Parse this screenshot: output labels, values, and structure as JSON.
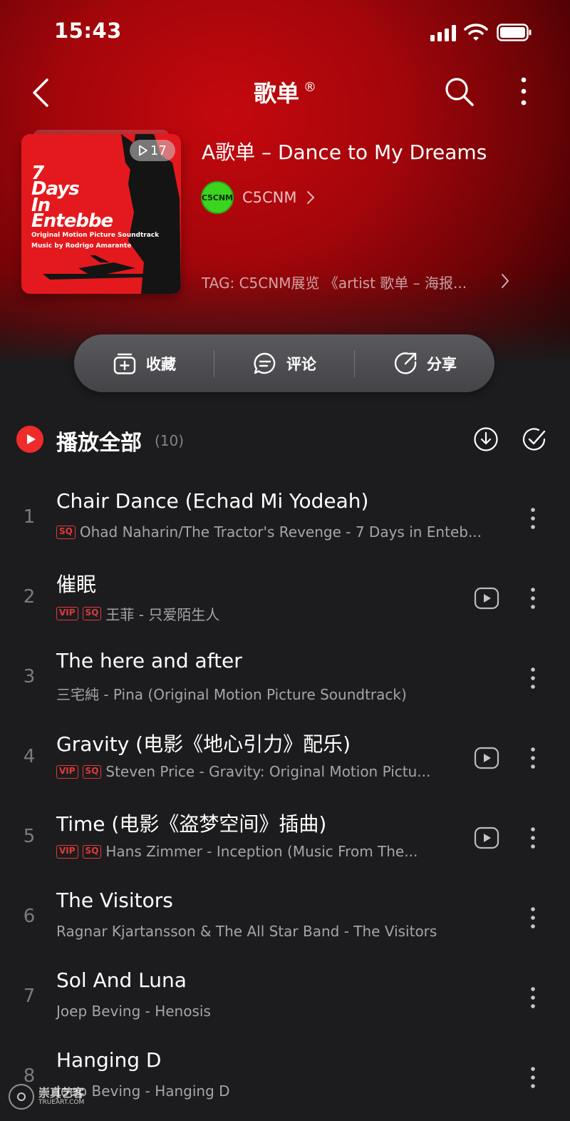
{
  "status_bar": {
    "time": "15:43"
  },
  "nav": {
    "title": "歌单",
    "title_mark": "®"
  },
  "playlist": {
    "cover": {
      "line1": "7",
      "line2": "Days",
      "line3": "In",
      "line4": "Entebbe",
      "line5": "Original Motion Picture Soundtrack",
      "line6": "Music by Rodrigo Amarante"
    },
    "play_count": "17",
    "title": "A歌单 – Dance to My Dreams",
    "creator_avatar_text": "C5CNM",
    "creator": "C5CNM",
    "tag_line": "TAG: C5CNM展览 《artist 歌单 – 海报..."
  },
  "actions": {
    "collect": "收藏",
    "comment": "评论",
    "share": "分享"
  },
  "play_all": {
    "label": "播放全部",
    "count": "(10)"
  },
  "tracks": [
    {
      "num": "1",
      "title": "Chair Dance (Echad Mi Yodeah)",
      "badges": [
        "SQ"
      ],
      "artist": "Ohad Naharin/The Tractor's Revenge - 7 Days in Enteb...",
      "mv": false
    },
    {
      "num": "2",
      "title": "催眠",
      "badges": [
        "VIP",
        "SQ"
      ],
      "artist": "王菲 - 只爱陌生人",
      "mv": true
    },
    {
      "num": "3",
      "title": "The here and after",
      "badges": [],
      "artist": "三宅純 - Pina (Original Motion Picture Soundtrack)",
      "mv": false
    },
    {
      "num": "4",
      "title": "Gravity (电影《地心引力》配乐)",
      "badges": [
        "VIP",
        "SQ"
      ],
      "artist": "Steven Price - Gravity: Original Motion Pictu...",
      "mv": true
    },
    {
      "num": "5",
      "title": "Time (电影《盗梦空间》插曲)",
      "badges": [
        "VIP",
        "SQ"
      ],
      "artist": "Hans Zimmer - Inception (Music From The...",
      "mv": true
    },
    {
      "num": "6",
      "title": "The Visitors",
      "badges": [],
      "artist": "Ragnar Kjartansson & The All Star Band - The Visitors",
      "mv": false
    },
    {
      "num": "7",
      "title": "Sol And Luna",
      "badges": [],
      "artist": "Joep Beving - Henosis",
      "mv": false
    },
    {
      "num": "8",
      "title": "Hanging D",
      "badges": [],
      "artist": "Joep Beving - Hanging D",
      "mv": false
    }
  ],
  "watermark": {
    "text": "崇真艺客",
    "sub": "TRUEART.COM"
  },
  "colors": {
    "accent": "#ef2b2b",
    "background": "#1c1c1e",
    "hero": "#c4080e",
    "creator_avatar": "#3bd41f"
  }
}
